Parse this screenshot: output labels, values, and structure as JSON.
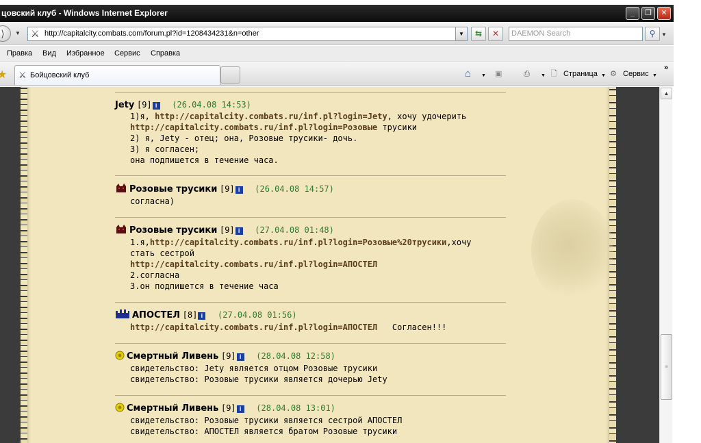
{
  "window": {
    "title": "цовский клуб - Windows Internet Explorer",
    "minimize": "_",
    "restore": "❐",
    "close": "✕"
  },
  "address": {
    "url": "http://capitalcity.combats.com/forum.pl?id=1208434231&n=other",
    "search_placeholder": "DAEMON Search"
  },
  "menu": [
    "Правка",
    "Вид",
    "Избранное",
    "Сервис",
    "Справка"
  ],
  "tab": {
    "label": "Бойцовский клуб"
  },
  "toolbar": {
    "page": "Страница",
    "service": "Сервис",
    "more": "»"
  },
  "posts": [
    {
      "author": "Jety",
      "level": "[9]",
      "date": "(26.04.08 14:53)",
      "lines": [
        [
          {
            "t": "1)я, "
          },
          {
            "t": "http://capitalcity.combats.ru/inf.pl?login=Jety",
            "b": 1
          },
          {
            "t": ", хочу удочерить"
          }
        ],
        [
          {
            "t": "http://capitalcity.combats.ru/inf.pl?login=Розовые",
            "b": 1
          },
          {
            "t": " трусики"
          }
        ],
        [
          {
            "t": "2) я, Jety - отец; она, Розовые трусики- дочь."
          }
        ],
        [
          {
            "t": "3) я согласен;"
          }
        ],
        [
          {
            "t": "она подпишется в течение часа."
          }
        ]
      ]
    },
    {
      "author": "Розовые трусики",
      "level": "[9]",
      "date": "(26.04.08 14:57)",
      "lines": [
        [
          {
            "t": "согласна)"
          }
        ]
      ]
    },
    {
      "author": "Розовые трусики",
      "level": "[9]",
      "date": "(27.04.08 01:48)",
      "lines": [
        [
          {
            "t": "1.я,"
          },
          {
            "t": "http://capitalcity.combats.ru/inf.pl?login=Розовые%20трусики",
            "b": 1
          },
          {
            "t": ",хочу"
          }
        ],
        [
          {
            "t": "стать сестрой"
          }
        ],
        [
          {
            "t": "http://capitalcity.combats.ru/inf.pl?login=АПОСТЕЛ",
            "b": 1
          }
        ],
        [
          {
            "t": "2.согласна"
          }
        ],
        [
          {
            "t": "3.он подпишется в течение часа"
          }
        ]
      ]
    },
    {
      "author": "АПОСТЕЛ",
      "level": "[8]",
      "date": "(27.04.08 01:56)",
      "lines": [
        [
          {
            "t": "http://capitalcity.combats.ru/inf.pl?login=АПОСТЕЛ",
            "b": 1
          },
          {
            "t": "   Согласен!!!"
          }
        ]
      ]
    },
    {
      "author": "Смертный Ливень",
      "level": "[9]",
      "date": "(28.04.08 12:58)",
      "lines": [
        [
          {
            "t": "свидетельство: Jety является отцом Розовые трусики"
          }
        ],
        [
          {
            "t": "свидетельство: Розовые трусики является дочерью Jety"
          }
        ]
      ]
    },
    {
      "author": "Смертный Ливень",
      "level": "[9]",
      "date": "(28.04.08 13:01)",
      "lines": [
        [
          {
            "t": "свидетельство: Розовые трусики является сестрой АПОСТЕЛ"
          }
        ],
        [
          {
            "t": "свидетельство: АПОСТЕЛ является братом Розовые трусики"
          }
        ]
      ]
    }
  ],
  "icons": {
    "info": "i"
  },
  "colors": {
    "paper": "#f1e6be",
    "date": "#2a7a2a",
    "link": "#5a3e1b",
    "info": "#1c3e9e"
  }
}
